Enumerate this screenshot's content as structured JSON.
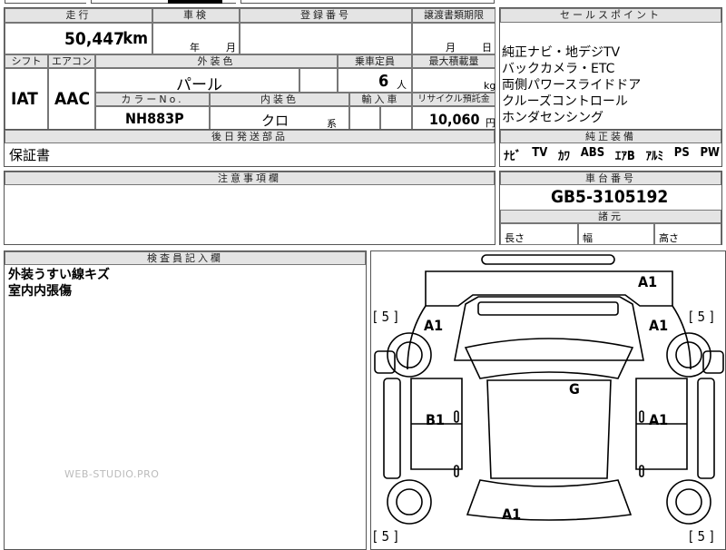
{
  "top_header": {
    "mileage": "走行",
    "inspection": "車検",
    "registration": "登録番号",
    "transfer_deadline": "譲渡書類期限",
    "sales_point": "セールスポイント"
  },
  "mileage": {
    "value": "50,447",
    "unit": "km"
  },
  "inspection": {
    "year_unit": "年",
    "month_unit": "月"
  },
  "transfer_deadline": {
    "month_unit": "月",
    "day_unit": "日"
  },
  "row2_header": {
    "shift": "シフト",
    "aircon": "エアコン",
    "exterior_color": "外装色",
    "capacity": "乗車定員",
    "max_load": "最大積載量"
  },
  "shift": {
    "value": "IAT"
  },
  "aircon": {
    "value": "AAC"
  },
  "exterior_color": {
    "value": "パール"
  },
  "capacity": {
    "value": "6",
    "unit": "人"
  },
  "max_load": {
    "unit": "kg"
  },
  "row3_header": {
    "color_no": "カラーNo.",
    "interior_color": "内装色",
    "import": "輸入車",
    "recycle": "リサイクル預託金"
  },
  "color_no": {
    "value": "NH883P"
  },
  "interior_color": {
    "value": "クロ",
    "suffix": "系"
  },
  "recycle": {
    "value": "10,060",
    "unit": "円"
  },
  "sales_points": [
    "純正ナビ・地デジTV",
    "バックカメラ・ETC",
    "両側パワースライドドア",
    "クルーズコントロール",
    "ホンダセンシング"
  ],
  "later_parts": {
    "header": "後日発送部品",
    "value": "保証書"
  },
  "equipment": {
    "header": "純正装備",
    "items": [
      "ﾅﾋﾞ",
      "TV",
      "ｶﾜ",
      "ABS",
      "ｴｱB",
      "ｱﾙﾐ",
      "PS",
      "PW"
    ]
  },
  "notes": {
    "header": "注意事項欄"
  },
  "chassis": {
    "header": "車台番号",
    "value": "GB5-3105192"
  },
  "specs": {
    "header": "諸元",
    "length": "長さ",
    "width": "幅",
    "height": "高さ"
  },
  "inspector": {
    "header": "検査員記入欄",
    "lines": [
      "外装うすい線キズ",
      "室内内張傷"
    ]
  },
  "diagram": {
    "marks": {
      "front_top": "A1",
      "front_left": "A1",
      "front_right": "A1",
      "roof": "G",
      "left_side": "B1",
      "right_side": "A1",
      "rear": "A1"
    },
    "tire_labels": [
      "[ 5 ]",
      "[ 5 ]",
      "[ 5 ]",
      "[ 5 ]"
    ]
  },
  "watermark": "WEB-STUDIO.PRO"
}
